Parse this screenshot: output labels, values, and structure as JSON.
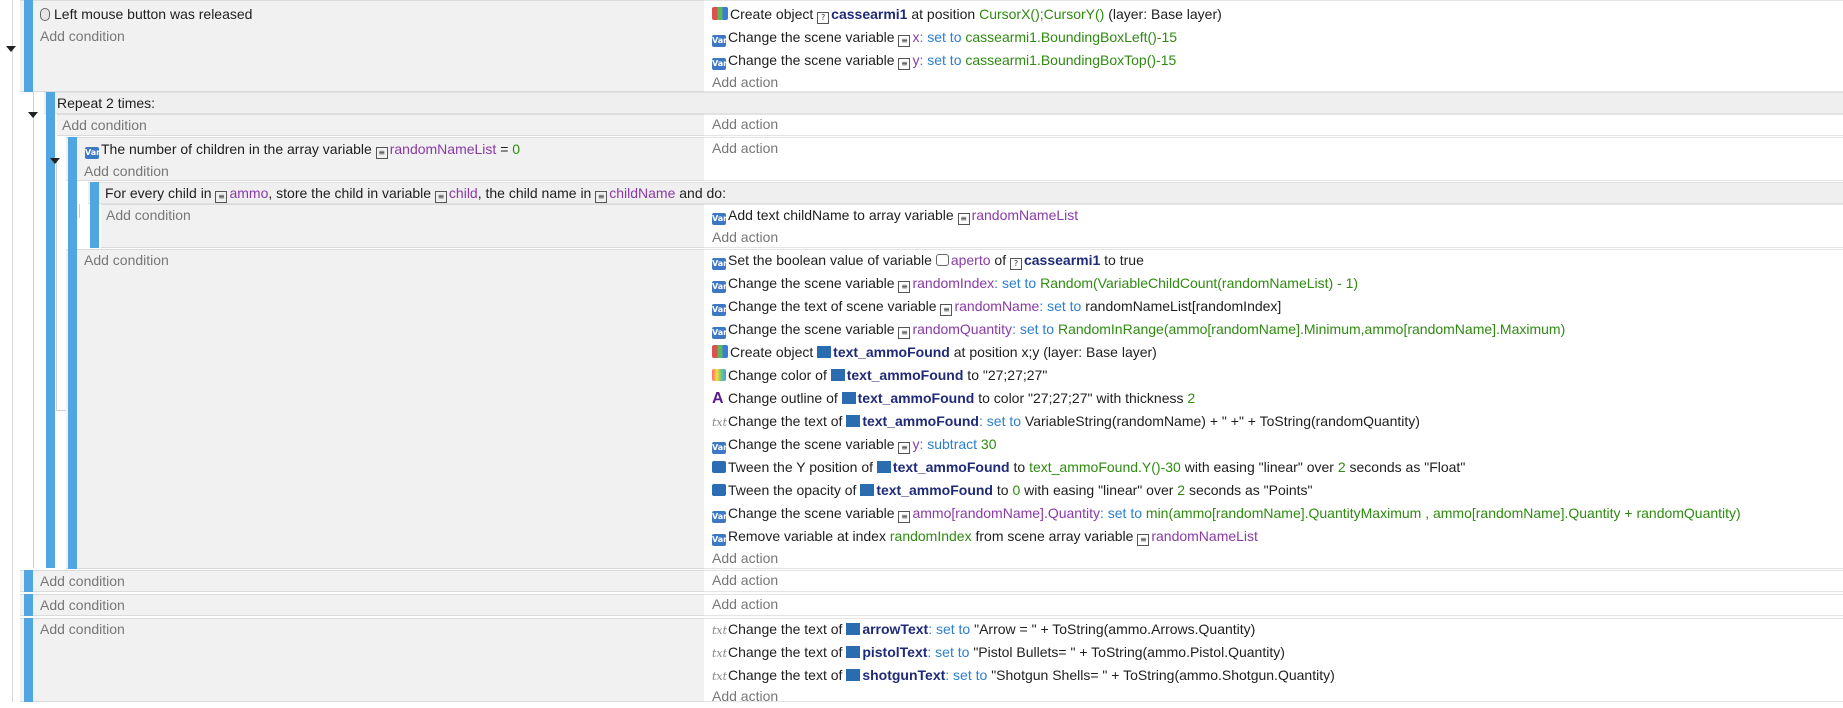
{
  "event1": {
    "condition": "Left mouse button was released",
    "add_condition": "Add condition",
    "actions": [
      {
        "pre": "Create object ",
        "obj": "cassearmi1",
        "mid": " at position ",
        "val": "CursorX();CursorY()",
        "post": " (layer: Base layer)"
      },
      {
        "pre": "Change the scene variable ",
        "var": "x",
        "kw": ": set to ",
        "val": "cassearmi1.BoundingBoxLeft()-15"
      },
      {
        "pre": "Change the scene variable ",
        "var": "y",
        "kw": ": set to ",
        "val": "cassearmi1.BoundingBoxTop()-15"
      }
    ],
    "add_action": "Add action"
  },
  "repeat": {
    "label": "Repeat 2 times:",
    "add_condition": "Add condition",
    "add_action": "Add action"
  },
  "event_children": {
    "pre": "The number of children in the array variable ",
    "var": "randomNameList",
    "op": " = ",
    "val": "0",
    "add_condition": "Add condition",
    "add_action": "Add action"
  },
  "foreach": {
    "p1": "For every child in ",
    "v1": "ammo",
    "p2": ", store the child in variable ",
    "v2": "child",
    "p3": ", the child name in ",
    "v3": "childName",
    "p4": " and do:",
    "add_condition": "Add condition",
    "action": {
      "pre": "Add text childName to array variable ",
      "var": "randomNameList"
    },
    "add_action": "Add action"
  },
  "event_main": {
    "add_condition": "Add condition",
    "a1": {
      "pre": "Set the boolean value of variable ",
      "var": "aperto",
      "mid": " of ",
      "obj": "cassearmi1",
      "post": " to true"
    },
    "a2": {
      "pre": "Change the scene variable ",
      "var": "randomIndex",
      "kw": ": set to ",
      "val": "Random(VariableChildCount(randomNameList) - 1)"
    },
    "a3": {
      "pre": "Change the text of scene variable ",
      "var": "randomName",
      "kw": ": set to ",
      "post": "randomNameList[randomIndex]"
    },
    "a4": {
      "pre": "Change the scene variable ",
      "var": "randomQuantity",
      "kw": ": set to ",
      "val": "RandomInRange(ammo[randomName].Minimum,ammo[randomName].Maximum)"
    },
    "a5": {
      "pre": "Create object ",
      "obj": "text_ammoFound",
      "mid": " at position ",
      "post": "x;y (layer: Base layer)"
    },
    "a6": {
      "pre": "Change color of ",
      "obj": "text_ammoFound",
      "post": " to \"27;27;27\""
    },
    "a7": {
      "pre": "Change outline of ",
      "obj": "text_ammoFound",
      "post": " to color \"27;27;27\" with thickness ",
      "val": "2"
    },
    "a8": {
      "pre": "Change the text of ",
      "obj": "text_ammoFound",
      "kw": ": set to ",
      "post": "VariableString(randomName) + \" +\" + ToString(randomQuantity)"
    },
    "a9": {
      "pre": "Change the scene variable ",
      "var": "y",
      "kw": ": subtract ",
      "val": "30"
    },
    "a10": {
      "pre": "Tween the Y position of ",
      "obj": "text_ammoFound",
      "mid": " to ",
      "val": "text_ammoFound.Y()-30",
      "post": " with easing \"linear\" over ",
      "val2": "2",
      "post2": " seconds as \"Float\""
    },
    "a11": {
      "pre": "Tween the opacity of ",
      "obj": "text_ammoFound",
      "mid": " to ",
      "val": "0",
      "post": " with easing \"linear\" over ",
      "val2": "2",
      "post2": " seconds as \"Points\""
    },
    "a12": {
      "pre": "Change the scene variable ",
      "var": "ammo[randomName].Quantity",
      "kw": ": set to ",
      "val": "min(ammo[randomName].QuantityMaximum , ammo[randomName].Quantity + randomQuantity)"
    },
    "a13": {
      "pre": "Remove variable at index ",
      "val": "randomIndex",
      "mid": " from scene array variable ",
      "var": "randomNameList"
    },
    "add_action": "Add action"
  },
  "empty1": {
    "add_condition": "Add condition",
    "add_action": "Add action"
  },
  "empty2": {
    "add_condition": "Add condition",
    "add_action": "Add action"
  },
  "event_text": {
    "add_condition": "Add condition",
    "t1": {
      "pre": "Change the text of ",
      "obj": "arrowText",
      "kw": ": set to ",
      "post": "\"Arrow = \" + ToString(ammo.Arrows.Quantity)"
    },
    "t2": {
      "pre": "Change the text of ",
      "obj": "pistolText",
      "kw": ": set to ",
      "post": "\"Pistol Bullets= \" + ToString(ammo.Pistol.Quantity)"
    },
    "t3": {
      "pre": "Change the text of ",
      "obj": "shotgunText",
      "kw": ": set to ",
      "post": "\"Shotgun Shells= \" + ToString(ammo.Shotgun.Quantity)"
    },
    "add_action": "Add action"
  }
}
